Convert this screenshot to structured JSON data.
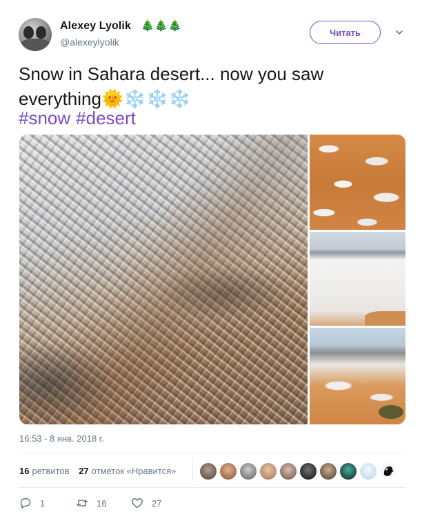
{
  "tweet": {
    "author_name": "Alexey Lyolik",
    "author_emoji": "🎄🎄🎄",
    "author_handle": "@alexeylyolik",
    "follow_label": "Читать",
    "text_line1": "Snow in Sahara desert... now you saw",
    "text_line2_word": "everything",
    "text_emoji": "🌞❄️❄️❄️",
    "hashtags": [
      "#snow",
      "#desert"
    ],
    "timestamp": "16:53 - 8 янв. 2018 г."
  },
  "stats": {
    "retweets_count": "16",
    "retweets_label": "ретвитов",
    "likes_count": "27",
    "likes_label": "отметок «Нравится»"
  },
  "actions": {
    "reply_count": "1",
    "retweet_count": "16",
    "like_count": "27"
  },
  "colors": {
    "accent": "#794bc4",
    "secondary_text": "#657786",
    "divider": "#e6ecf0"
  },
  "icons": [
    "chevron-down-icon",
    "reply-icon",
    "retweet-icon",
    "heart-icon"
  ]
}
